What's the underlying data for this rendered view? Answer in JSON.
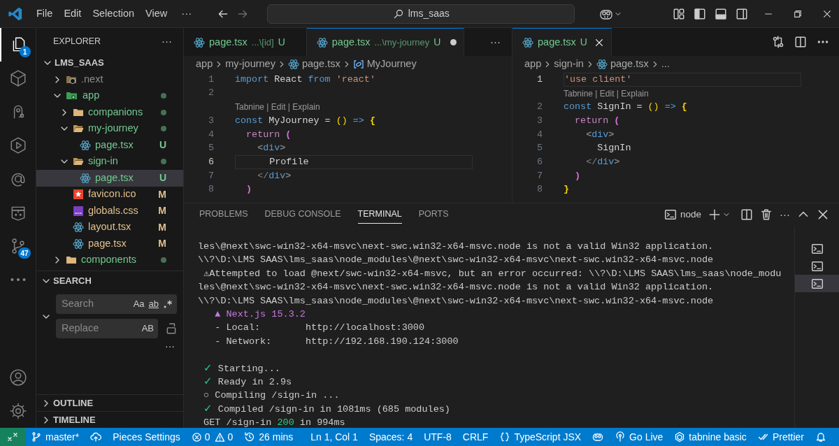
{
  "title_bar": {
    "menu": [
      "File",
      "Edit",
      "Selection",
      "View"
    ],
    "more": "···",
    "search": "lms_saas"
  },
  "activity_bar": {
    "items": [
      {
        "kind": "files",
        "selected": true,
        "badge": "1"
      },
      {
        "kind": "box",
        "selected": false
      },
      {
        "kind": "pieces",
        "selected": false
      },
      {
        "kind": "run",
        "selected": false
      },
      {
        "kind": "at",
        "selected": false
      },
      {
        "kind": "package",
        "selected": false
      },
      {
        "kind": "source-control",
        "selected": false,
        "badge": "47"
      },
      {
        "kind": "more",
        "selected": false
      }
    ],
    "bottom": [
      {
        "kind": "account"
      },
      {
        "kind": "settings"
      }
    ]
  },
  "explorer": {
    "title": "EXPLORER",
    "more": "···",
    "root": {
      "label": "LMS_SAAS",
      "expanded": true
    },
    "items": [
      {
        "label": ".next",
        "kind": "next-folder",
        "expanded": false,
        "color": "#8c8c8c",
        "selected": false
      },
      {
        "label": "app",
        "kind": "app-folder",
        "expanded": true,
        "color": "#73c991",
        "dot": true,
        "selected": false,
        "children": [
          {
            "label": "companions",
            "kind": "folder",
            "expanded": false,
            "color": "#73c991",
            "dot": true,
            "selected": false
          },
          {
            "label": "my-journey",
            "kind": "folder",
            "expanded": true,
            "color": "#73c991",
            "dot": true,
            "selected": false,
            "children": [
              {
                "label": "page.tsx",
                "kind": "react",
                "color": "#73c991",
                "badge": "U",
                "selected": false
              }
            ]
          },
          {
            "label": "sign-in",
            "kind": "folder",
            "expanded": true,
            "color": "#73c991",
            "dot": true,
            "selected": false,
            "children": [
              {
                "label": "page.tsx",
                "kind": "react",
                "color": "#73c991",
                "badge": "U",
                "selected": true
              }
            ]
          },
          {
            "label": "favicon.ico",
            "kind": "favicon",
            "color": "#e2c08d",
            "badge": "M",
            "selected": false
          },
          {
            "label": "globals.css",
            "kind": "css",
            "color": "#e2c08d",
            "badge": "M",
            "selected": false
          },
          {
            "label": "layout.tsx",
            "kind": "react",
            "color": "#e2c08d",
            "badge": "M",
            "selected": false
          },
          {
            "label": "page.tsx",
            "kind": "react",
            "color": "#e2c08d",
            "badge": "M",
            "selected": false
          }
        ]
      },
      {
        "label": "components",
        "kind": "folder",
        "expanded": false,
        "color": "#73c991",
        "dot": true,
        "selected": false
      }
    ]
  },
  "search": {
    "title": "SEARCH",
    "expanded": true,
    "search_placeholder": "Search",
    "replace_placeholder": "Replace",
    "case_toggle": "Aa",
    "word_toggle": "ab",
    "preserve_case": "AB",
    "more": "···"
  },
  "collapsed_sections": [
    {
      "label": "OUTLINE",
      "expanded": false
    },
    {
      "label": "TIMELINE",
      "expanded": false
    }
  ],
  "editor_groups": [
    {
      "tabs": [
        {
          "label": "page.tsx",
          "description": "...\\[id]",
          "badge": "U",
          "selected": false,
          "dirty": false
        },
        {
          "label": "page.tsx",
          "description": "...\\my-journey",
          "badge": "U",
          "selected": true,
          "dirty": true
        }
      ],
      "more": "···",
      "breadcrumbs": [
        {
          "text": "app"
        },
        {
          "text": "my-journey"
        },
        {
          "text": "page.tsx",
          "kind": "react"
        },
        {
          "text": "MyJourney",
          "kind": "symbol"
        }
      ],
      "lines": [
        {
          "kind": "code",
          "number": "1",
          "current": false,
          "tokens": [
            {
              "text": "import",
              "color": "#569cd6"
            },
            {
              "text": " React ",
              "color": "#d4d4d4"
            },
            {
              "text": "from",
              "color": "#569cd6"
            },
            {
              "text": " 'react'",
              "color": "#ce9178"
            }
          ]
        },
        {
          "kind": "code",
          "number": "2",
          "current": false
        },
        {
          "kind": "lens",
          "text": "Tabnine | Edit | Explain"
        },
        {
          "kind": "code",
          "number": "3",
          "current": false,
          "tokens": [
            {
              "text": "const",
              "color": "#569cd6"
            },
            {
              "text": " MyJourney = ",
              "color": "#d4d4d4"
            },
            {
              "text": "()",
              "color": "#ffd700"
            },
            {
              "text": " =>",
              "color": "#569cd6"
            },
            {
              "text": " {",
              "color": "#ffd700"
            }
          ]
        },
        {
          "kind": "code",
          "number": "4",
          "current": false,
          "tokens": [
            {
              "text": "  return",
              "color": "#c586c0"
            },
            {
              "text": " (",
              "color": "#da70d6"
            }
          ]
        },
        {
          "kind": "code",
          "number": "5",
          "current": false,
          "tokens": [
            {
              "text": "    <",
              "color": "#808080"
            },
            {
              "text": "div",
              "color": "#569cd6"
            },
            {
              "text": ">",
              "color": "#808080"
            }
          ]
        },
        {
          "kind": "code",
          "number": "6",
          "current": true,
          "tokens": [
            {
              "text": "      Profile",
              "color": "#d4d4d4"
            }
          ]
        },
        {
          "kind": "code",
          "number": "7",
          "current": false,
          "tokens": [
            {
              "text": "    </",
              "color": "#808080"
            },
            {
              "text": "div",
              "color": "#569cd6"
            },
            {
              "text": ">",
              "color": "#808080"
            }
          ]
        },
        {
          "kind": "code",
          "number": "8",
          "current": false,
          "tokens": [
            {
              "text": "  )",
              "color": "#da70d6"
            }
          ]
        }
      ]
    },
    {
      "tabs": [
        {
          "label": "page.tsx",
          "badge": "U",
          "selected": true,
          "dirty": false
        }
      ],
      "breadcrumbs": [
        {
          "text": "app"
        },
        {
          "text": "sign-in"
        },
        {
          "text": "page.tsx",
          "kind": "react"
        },
        {
          "text": "..."
        }
      ],
      "lines": [
        {
          "kind": "code",
          "number": "1",
          "current": true,
          "tokens": [
            {
              "text": "'use client'",
              "color": "#ce9178"
            }
          ]
        },
        {
          "kind": "lens",
          "text": "Tabnine | Edit | Explain"
        },
        {
          "kind": "code",
          "number": "2",
          "current": false,
          "tokens": [
            {
              "text": "const",
              "color": "#569cd6"
            },
            {
              "text": " SignIn = ",
              "color": "#d4d4d4"
            },
            {
              "text": "()",
              "color": "#ffd700"
            },
            {
              "text": " =>",
              "color": "#569cd6"
            },
            {
              "text": " {",
              "color": "#ffd700"
            }
          ]
        },
        {
          "kind": "code",
          "number": "3",
          "current": false,
          "tokens": [
            {
              "text": "  return",
              "color": "#c586c0"
            },
            {
              "text": " (",
              "color": "#da70d6"
            }
          ]
        },
        {
          "kind": "code",
          "number": "4",
          "current": false,
          "tokens": [
            {
              "text": "    <",
              "color": "#808080"
            },
            {
              "text": "div",
              "color": "#569cd6"
            },
            {
              "text": ">",
              "color": "#808080"
            }
          ]
        },
        {
          "kind": "code",
          "number": "5",
          "current": false,
          "tokens": [
            {
              "text": "      SignIn",
              "color": "#d4d4d4"
            }
          ]
        },
        {
          "kind": "code",
          "number": "6",
          "current": false,
          "tokens": [
            {
              "text": "    </",
              "color": "#808080"
            },
            {
              "text": "div",
              "color": "#569cd6"
            },
            {
              "text": ">",
              "color": "#808080"
            }
          ]
        },
        {
          "kind": "code",
          "number": "7",
          "current": false,
          "tokens": [
            {
              "text": "  )",
              "color": "#da70d6"
            }
          ]
        },
        {
          "kind": "code",
          "number": "8",
          "current": false,
          "tokens": [
            {
              "text": "}",
              "color": "#ffd700"
            }
          ]
        }
      ]
    }
  ],
  "panel": {
    "tabs": [
      {
        "label": "PROBLEMS",
        "selected": false
      },
      {
        "label": "DEBUG CONSOLE",
        "selected": false
      },
      {
        "label": "TERMINAL",
        "selected": true
      },
      {
        "label": "PORTS",
        "selected": false
      }
    ],
    "terminal_name": "node",
    "more": "···",
    "terminals": [
      {
        "selected": false
      },
      {
        "selected": false
      },
      {
        "selected": true
      }
    ],
    "lines": [
      {
        "kind": "text",
        "tokens": [
          {
            "text": "les\\@next\\swc-win32-x64-msvc\\next-swc.win32-x64-msvc.node is not a valid Win32 application.",
            "color": "#cccccc"
          }
        ]
      },
      {
        "kind": "text",
        "tokens": [
          {
            "text": "\\\\?\\D:\\LMS SAAS\\lms_saas\\node_modules\\@next\\swc-win32-x64-msvc\\next-swc.win32-x64-msvc.node",
            "color": "#cccccc"
          }
        ]
      },
      {
        "kind": "text",
        "tokens": [
          {
            "text": " ⚠Attempted to load @next/swc-win32-x64-msvc, but an error occurred: \\\\?\\D:\\LMS SAAS\\lms_saas\\node_modu",
            "color": "#cccccc"
          }
        ]
      },
      {
        "kind": "text",
        "tokens": [
          {
            "text": "les\\@next\\swc-win32-x64-msvc\\next-swc.win32-x64-msvc.node is not a valid Win32 application.",
            "color": "#cccccc"
          }
        ]
      },
      {
        "kind": "text",
        "tokens": [
          {
            "text": "\\\\?\\D:\\LMS SAAS\\lms_saas\\node_modules\\@next\\swc-win32-x64-msvc\\next-swc.win32-x64-msvc.node",
            "color": "#cccccc"
          }
        ]
      },
      {
        "kind": "text",
        "tokens": [
          {
            "text": "   ▲ Next.js 15.3.2",
            "color": "#c678dd"
          }
        ]
      },
      {
        "kind": "text",
        "tokens": [
          {
            "text": "   - Local:        http://localhost:3000",
            "color": "#cccccc"
          }
        ]
      },
      {
        "kind": "text",
        "tokens": [
          {
            "text": "   - Network:      http://192.168.190.124:3000",
            "color": "#cccccc"
          }
        ]
      },
      {
        "kind": "blank"
      },
      {
        "kind": "text",
        "tokens": [
          {
            "text": " ✓",
            "color": "#23d18b"
          },
          {
            "text": " Starting...",
            "color": "#cccccc"
          }
        ]
      },
      {
        "kind": "text",
        "tokens": [
          {
            "text": " ✓",
            "color": "#23d18b"
          },
          {
            "text": " Ready in 2.9s",
            "color": "#cccccc"
          }
        ]
      },
      {
        "kind": "text",
        "tokens": [
          {
            "text": " ○ Compiling /sign-in ...",
            "color": "#cccccc"
          }
        ]
      },
      {
        "kind": "text",
        "tokens": [
          {
            "text": " ✓",
            "color": "#23d18b"
          },
          {
            "text": " Compiled /sign-in in 1081ms (685 modules)",
            "color": "#cccccc"
          }
        ]
      },
      {
        "kind": "text",
        "tokens": [
          {
            "text": " GET /sign-in ",
            "color": "#cccccc"
          },
          {
            "text": "200",
            "color": "#23d18b"
          },
          {
            "text": " in 994ms",
            "color": "#cccccc"
          }
        ]
      }
    ]
  },
  "status_bar": {
    "left": [
      {
        "kind": "remote"
      },
      {
        "kind": "branch",
        "text": "master*"
      },
      {
        "kind": "sync"
      },
      {
        "kind": "text",
        "text": "Pieces Settings"
      },
      {
        "kind": "problems",
        "errors": "0",
        "warnings": "0"
      },
      {
        "kind": "timer",
        "text": "26 mins"
      }
    ],
    "right": [
      {
        "kind": "text",
        "text": "Ln 1, Col 1"
      },
      {
        "kind": "text",
        "text": "Spaces: 4"
      },
      {
        "kind": "text",
        "text": "UTF-8"
      },
      {
        "kind": "text",
        "text": "CRLF"
      },
      {
        "kind": "language",
        "text": "TypeScript JSX"
      },
      {
        "kind": "assistant"
      },
      {
        "kind": "live",
        "text": "Go Live"
      },
      {
        "kind": "tabnine",
        "text": "tabnine basic"
      },
      {
        "kind": "prettier",
        "text": "Prettier"
      },
      {
        "kind": "bell"
      }
    ]
  }
}
